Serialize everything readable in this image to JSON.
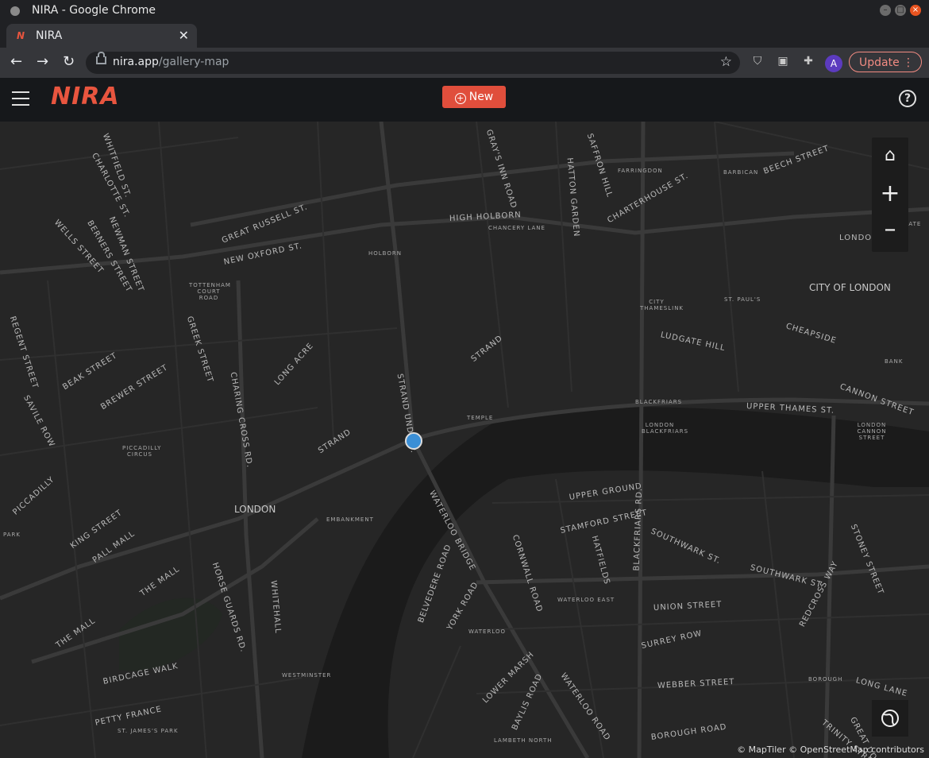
{
  "window": {
    "title": "NIRA - Google Chrome"
  },
  "tab": {
    "title": "NIRA",
    "favicon": "N"
  },
  "toolbar": {
    "url_host": "nira.app",
    "url_path": "/gallery-map",
    "profile_initial": "A",
    "update_label": "Update"
  },
  "app": {
    "logo": "NIRA",
    "new_label": "New",
    "help": "?"
  },
  "map": {
    "labels": [
      {
        "text": "WHITFIELD ST.",
        "cls": ""
      },
      {
        "text": "CHARLOTTE ST.",
        "cls": ""
      },
      {
        "text": "WELLS STREET",
        "cls": ""
      },
      {
        "text": "BERNERS STREET",
        "cls": ""
      },
      {
        "text": "NEWMAN STREET",
        "cls": ""
      },
      {
        "text": "GREAT RUSSELL ST.",
        "cls": ""
      },
      {
        "text": "NEW OXFORD ST.",
        "cls": ""
      },
      {
        "text": "TOTTENHAM COURT ROAD",
        "cls": "small"
      },
      {
        "text": "HOLBORN",
        "cls": "small"
      },
      {
        "text": "HIGH HOLBORN",
        "cls": ""
      },
      {
        "text": "CHANCERY LANE",
        "cls": "small"
      },
      {
        "text": "GRAY'S INN ROAD",
        "cls": ""
      },
      {
        "text": "HATTON GARDEN",
        "cls": ""
      },
      {
        "text": "SAFFRON HILL",
        "cls": ""
      },
      {
        "text": "FARRINGDON",
        "cls": "small"
      },
      {
        "text": "CHARTERHOUSE ST.",
        "cls": ""
      },
      {
        "text": "BARBICAN",
        "cls": "small"
      },
      {
        "text": "BEECH STREET",
        "cls": ""
      },
      {
        "text": "MOORGATE",
        "cls": "small"
      },
      {
        "text": "LONDON WALL",
        "cls": ""
      },
      {
        "text": "CITY OF LONDON",
        "cls": "city"
      },
      {
        "text": "CITY THAMESLINK",
        "cls": "small"
      },
      {
        "text": "ST. PAUL'S",
        "cls": "small"
      },
      {
        "text": "LUDGATE HILL",
        "cls": ""
      },
      {
        "text": "CHEAPSIDE",
        "cls": ""
      },
      {
        "text": "BANK",
        "cls": "small"
      },
      {
        "text": "REGENT STREET",
        "cls": ""
      },
      {
        "text": "GREEK STREET",
        "cls": ""
      },
      {
        "text": "BEAK STREET",
        "cls": ""
      },
      {
        "text": "BREWER STREET",
        "cls": ""
      },
      {
        "text": "SAVILE ROW",
        "cls": ""
      },
      {
        "text": "CHARING CROSS RD.",
        "cls": ""
      },
      {
        "text": "LONG ACRE",
        "cls": ""
      },
      {
        "text": "STRAND",
        "cls": ""
      },
      {
        "text": "STRAND UNDERP.",
        "cls": ""
      },
      {
        "text": "TEMPLE",
        "cls": "small"
      },
      {
        "text": "BLACKFRIARS",
        "cls": "small"
      },
      {
        "text": "LONDON BLACKFRIARS",
        "cls": "small"
      },
      {
        "text": "UPPER THAMES ST.",
        "cls": ""
      },
      {
        "text": "CANNON STREET",
        "cls": ""
      },
      {
        "text": "LONDON CANNON STREET",
        "cls": "small"
      },
      {
        "text": "PICCADILLY CIRCUS",
        "cls": "small"
      },
      {
        "text": "PICCADILLY",
        "cls": ""
      },
      {
        "text": "PARK",
        "cls": "small"
      },
      {
        "text": "KING STREET",
        "cls": ""
      },
      {
        "text": "PALL MALL",
        "cls": ""
      },
      {
        "text": "LONDON",
        "cls": "city"
      },
      {
        "text": "EMBANKMENT",
        "cls": "small"
      },
      {
        "text": "WATERLOO BRIDGE",
        "cls": ""
      },
      {
        "text": "UPPER GROUND",
        "cls": ""
      },
      {
        "text": "STAMFORD STREET",
        "cls": ""
      },
      {
        "text": "SOUTHWARK ST.",
        "cls": ""
      },
      {
        "text": "HATFIELDS",
        "cls": ""
      },
      {
        "text": "CORNWALL ROAD",
        "cls": ""
      },
      {
        "text": "STONEY STREET",
        "cls": ""
      },
      {
        "text": "THE MALL",
        "cls": ""
      },
      {
        "text": "HORSE GUARDS RD.",
        "cls": ""
      },
      {
        "text": "WHITEHALL",
        "cls": ""
      },
      {
        "text": "BELVEDERE ROAD",
        "cls": ""
      },
      {
        "text": "YORK ROAD",
        "cls": ""
      },
      {
        "text": "WATERLOO EAST",
        "cls": "small"
      },
      {
        "text": "UNION STREET",
        "cls": ""
      },
      {
        "text": "BLACKFRIARS RD.",
        "cls": ""
      },
      {
        "text": "REDCROSS WAY",
        "cls": ""
      },
      {
        "text": "WATERLOO",
        "cls": "small"
      },
      {
        "text": "SURREY ROW",
        "cls": ""
      },
      {
        "text": "BIRDCAGE WALK",
        "cls": ""
      },
      {
        "text": "WESTMINSTER",
        "cls": "small"
      },
      {
        "text": "LOWER MARSH",
        "cls": ""
      },
      {
        "text": "BAYLIS ROAD",
        "cls": ""
      },
      {
        "text": "WATERLOO ROAD",
        "cls": ""
      },
      {
        "text": "WEBBER STREET",
        "cls": ""
      },
      {
        "text": "BOROUGH",
        "cls": "small"
      },
      {
        "text": "LONG LANE",
        "cls": ""
      },
      {
        "text": "PETTY FRANCE",
        "cls": ""
      },
      {
        "text": "ST. JAMES'S PARK",
        "cls": "small"
      },
      {
        "text": "LAMBETH NORTH",
        "cls": "small"
      },
      {
        "text": "BOROUGH ROAD",
        "cls": ""
      },
      {
        "text": "TRINITY STREET",
        "cls": ""
      },
      {
        "text": "GREAT DOVER",
        "cls": ""
      }
    ],
    "attribution": "© MapTiler  © OpenStreetMap contributors"
  }
}
